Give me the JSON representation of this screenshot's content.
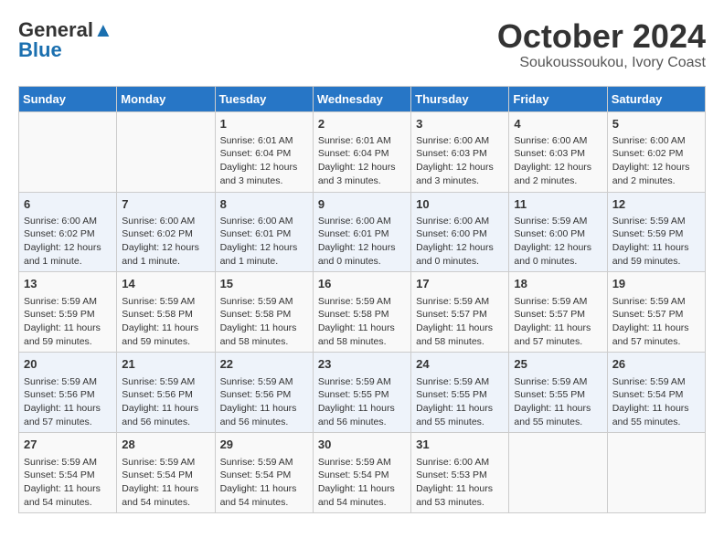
{
  "header": {
    "logo_general": "General",
    "logo_blue": "Blue",
    "month_title": "October 2024",
    "location": "Soukoussoukou, Ivory Coast"
  },
  "weekdays": [
    "Sunday",
    "Monday",
    "Tuesday",
    "Wednesday",
    "Thursday",
    "Friday",
    "Saturday"
  ],
  "weeks": [
    [
      {
        "day": "",
        "info": ""
      },
      {
        "day": "",
        "info": ""
      },
      {
        "day": "1",
        "info": "Sunrise: 6:01 AM\nSunset: 6:04 PM\nDaylight: 12 hours and 3 minutes."
      },
      {
        "day": "2",
        "info": "Sunrise: 6:01 AM\nSunset: 6:04 PM\nDaylight: 12 hours and 3 minutes."
      },
      {
        "day": "3",
        "info": "Sunrise: 6:00 AM\nSunset: 6:03 PM\nDaylight: 12 hours and 3 minutes."
      },
      {
        "day": "4",
        "info": "Sunrise: 6:00 AM\nSunset: 6:03 PM\nDaylight: 12 hours and 2 minutes."
      },
      {
        "day": "5",
        "info": "Sunrise: 6:00 AM\nSunset: 6:02 PM\nDaylight: 12 hours and 2 minutes."
      }
    ],
    [
      {
        "day": "6",
        "info": "Sunrise: 6:00 AM\nSunset: 6:02 PM\nDaylight: 12 hours and 1 minute."
      },
      {
        "day": "7",
        "info": "Sunrise: 6:00 AM\nSunset: 6:02 PM\nDaylight: 12 hours and 1 minute."
      },
      {
        "day": "8",
        "info": "Sunrise: 6:00 AM\nSunset: 6:01 PM\nDaylight: 12 hours and 1 minute."
      },
      {
        "day": "9",
        "info": "Sunrise: 6:00 AM\nSunset: 6:01 PM\nDaylight: 12 hours and 0 minutes."
      },
      {
        "day": "10",
        "info": "Sunrise: 6:00 AM\nSunset: 6:00 PM\nDaylight: 12 hours and 0 minutes."
      },
      {
        "day": "11",
        "info": "Sunrise: 5:59 AM\nSunset: 6:00 PM\nDaylight: 12 hours and 0 minutes."
      },
      {
        "day": "12",
        "info": "Sunrise: 5:59 AM\nSunset: 5:59 PM\nDaylight: 11 hours and 59 minutes."
      }
    ],
    [
      {
        "day": "13",
        "info": "Sunrise: 5:59 AM\nSunset: 5:59 PM\nDaylight: 11 hours and 59 minutes."
      },
      {
        "day": "14",
        "info": "Sunrise: 5:59 AM\nSunset: 5:58 PM\nDaylight: 11 hours and 59 minutes."
      },
      {
        "day": "15",
        "info": "Sunrise: 5:59 AM\nSunset: 5:58 PM\nDaylight: 11 hours and 58 minutes."
      },
      {
        "day": "16",
        "info": "Sunrise: 5:59 AM\nSunset: 5:58 PM\nDaylight: 11 hours and 58 minutes."
      },
      {
        "day": "17",
        "info": "Sunrise: 5:59 AM\nSunset: 5:57 PM\nDaylight: 11 hours and 58 minutes."
      },
      {
        "day": "18",
        "info": "Sunrise: 5:59 AM\nSunset: 5:57 PM\nDaylight: 11 hours and 57 minutes."
      },
      {
        "day": "19",
        "info": "Sunrise: 5:59 AM\nSunset: 5:57 PM\nDaylight: 11 hours and 57 minutes."
      }
    ],
    [
      {
        "day": "20",
        "info": "Sunrise: 5:59 AM\nSunset: 5:56 PM\nDaylight: 11 hours and 57 minutes."
      },
      {
        "day": "21",
        "info": "Sunrise: 5:59 AM\nSunset: 5:56 PM\nDaylight: 11 hours and 56 minutes."
      },
      {
        "day": "22",
        "info": "Sunrise: 5:59 AM\nSunset: 5:56 PM\nDaylight: 11 hours and 56 minutes."
      },
      {
        "day": "23",
        "info": "Sunrise: 5:59 AM\nSunset: 5:55 PM\nDaylight: 11 hours and 56 minutes."
      },
      {
        "day": "24",
        "info": "Sunrise: 5:59 AM\nSunset: 5:55 PM\nDaylight: 11 hours and 55 minutes."
      },
      {
        "day": "25",
        "info": "Sunrise: 5:59 AM\nSunset: 5:55 PM\nDaylight: 11 hours and 55 minutes."
      },
      {
        "day": "26",
        "info": "Sunrise: 5:59 AM\nSunset: 5:54 PM\nDaylight: 11 hours and 55 minutes."
      }
    ],
    [
      {
        "day": "27",
        "info": "Sunrise: 5:59 AM\nSunset: 5:54 PM\nDaylight: 11 hours and 54 minutes."
      },
      {
        "day": "28",
        "info": "Sunrise: 5:59 AM\nSunset: 5:54 PM\nDaylight: 11 hours and 54 minutes."
      },
      {
        "day": "29",
        "info": "Sunrise: 5:59 AM\nSunset: 5:54 PM\nDaylight: 11 hours and 54 minutes."
      },
      {
        "day": "30",
        "info": "Sunrise: 5:59 AM\nSunset: 5:54 PM\nDaylight: 11 hours and 54 minutes."
      },
      {
        "day": "31",
        "info": "Sunrise: 6:00 AM\nSunset: 5:53 PM\nDaylight: 11 hours and 53 minutes."
      },
      {
        "day": "",
        "info": ""
      },
      {
        "day": "",
        "info": ""
      }
    ]
  ]
}
